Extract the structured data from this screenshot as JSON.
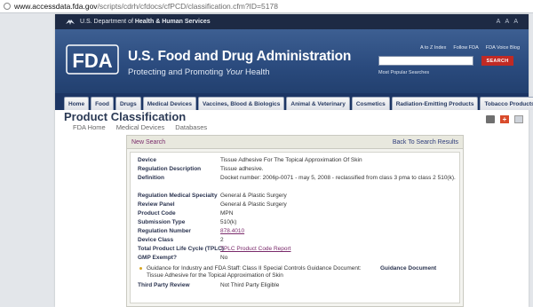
{
  "browser": {
    "url_host": "www.accessdata.fda.gov",
    "url_path": "/scripts/cdrh/cfdocs/cfPCD/classification.cfm?ID=5178"
  },
  "hhs": {
    "dept_prefix": "U.S. Department of ",
    "dept_name": "Health & Human Services",
    "text_sizes": "A A A"
  },
  "banner": {
    "logo_text": "FDA",
    "agency": "U.S. Food and Drug Administration",
    "tagline_prefix": "Protecting and Promoting ",
    "tagline_em": "Your",
    "tagline_suffix": " Health",
    "links": [
      "A to Z Index",
      "Follow FDA",
      "FDA Voice Blog"
    ],
    "search_button": "SEARCH",
    "popular": "Most Popular Searches"
  },
  "nav": {
    "tabs": [
      "Home",
      "Food",
      "Drugs",
      "Medical Devices",
      "Vaccines, Blood & Biologics",
      "Animal & Veterinary",
      "Cosmetics",
      "Radiation-Emitting Products",
      "Tobacco Products"
    ]
  },
  "page": {
    "title": "Product Classification",
    "crumbs": [
      "FDA Home",
      "Medical Devices",
      "Databases"
    ]
  },
  "results": {
    "new_search": "New Search",
    "back": "Back To Search Results",
    "device_label": "Device",
    "device_value": "Tissue Adhesive For The Topical Approximation Of Skin",
    "regdesc_label": "Regulation Description",
    "regdesc_value": "Tissue adhesive.",
    "def_label": "Definition",
    "def_value": "Docket number: 2006p-0071 - may 5, 2008 - reclassified from class 3 pma to class 2 510(k).",
    "medspec_label": "Regulation Medical Specialty",
    "medspec_value": "General & Plastic Surgery",
    "panel_label": "Review Panel",
    "panel_value": "General & Plastic Surgery",
    "code_label": "Product Code",
    "code_value": "MPN",
    "subtype_label": "Submission Type",
    "subtype_value": "510(k)",
    "regnum_label": "Regulation Number",
    "regnum_value": "878.4010",
    "class_label": "Device Class",
    "class_value": "2",
    "tplc_label": "Total Product Life Cycle (TPLC)",
    "tplc_value": "TPLC Product Code Report",
    "gmp_label": "GMP Exempt?",
    "gmp_value": "No",
    "guidance_line1": "Guidance for Industry and FDA Staff: Class II Special Controls Guidance Document:",
    "guidance_line2": "Tissue Adhesive for the Topical Approximation of Skin",
    "guidance_doc_label": "Guidance Document",
    "tpr_label": "Third Party Review",
    "tpr_value": "Not Third Party Eligible"
  },
  "colors": {
    "banner": "#2a4a7d",
    "nav": "#1c3564",
    "search_button": "#c12a24",
    "link_purple": "#7a2a6b"
  }
}
